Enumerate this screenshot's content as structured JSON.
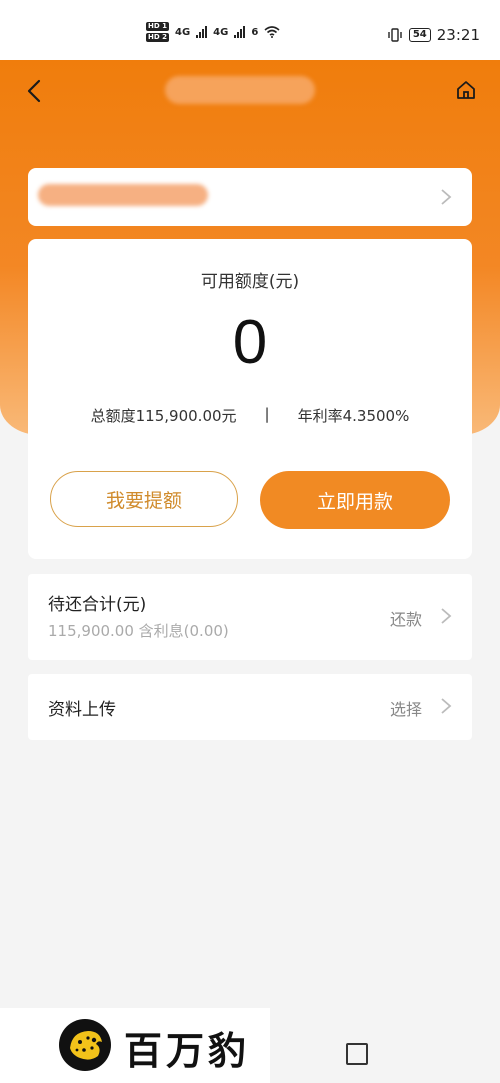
{
  "status_bar": {
    "hd_badges": [
      "HD 1",
      "HD 2"
    ],
    "net1": "4G",
    "net2": "4G",
    "wifi": "6",
    "battery": "54",
    "time": "23:21"
  },
  "credit": {
    "available_label": "可用额度(元)",
    "available_value": "0",
    "total_limit": "总额度115,900.00元",
    "separator": "|",
    "annual_rate": "年利率4.3500%",
    "raise_button": "我要提额",
    "use_button": "立即用款"
  },
  "repayment": {
    "title": "待还合计(元)",
    "summary": "115,900.00 含利息(0.00)",
    "action": "还款"
  },
  "upload": {
    "title": "资料上传",
    "action": "选择"
  },
  "watermark": {
    "text": "百万豹"
  },
  "colors": {
    "brand_orange": "#f18a23",
    "outline_gold": "#d9a24b"
  }
}
